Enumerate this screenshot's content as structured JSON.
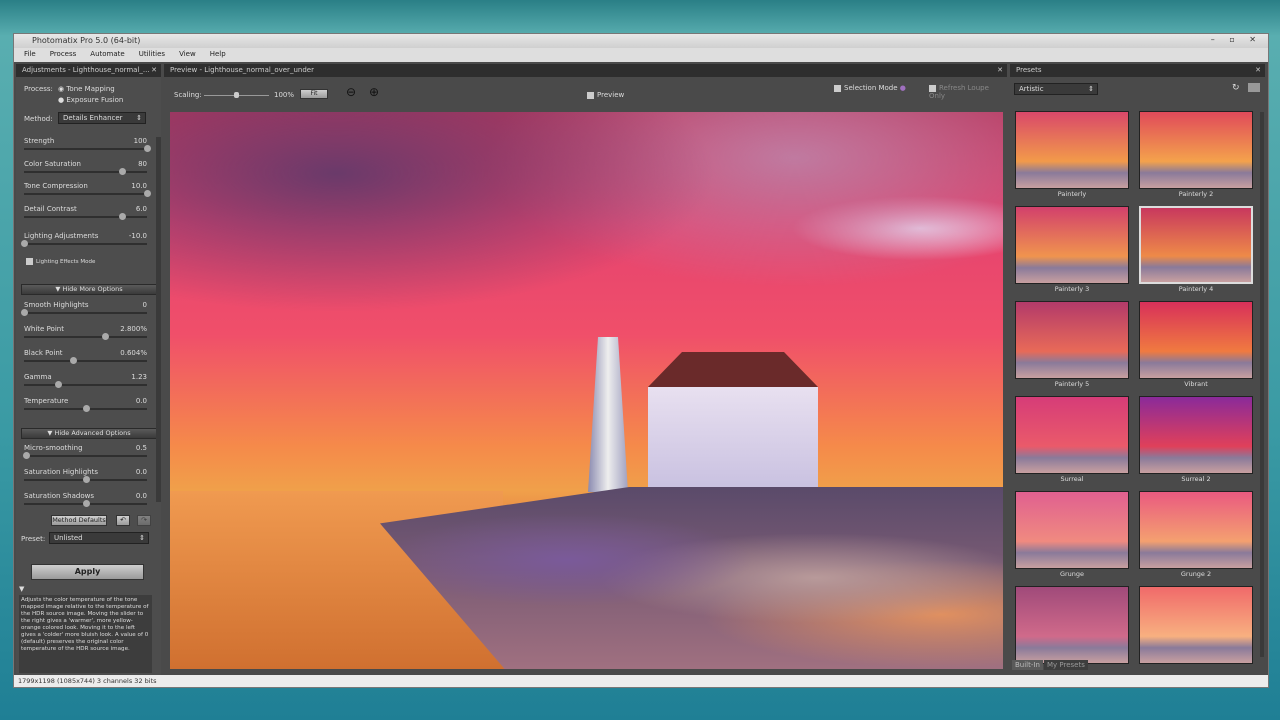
{
  "window": {
    "title": "Photomatix Pro 5.0 (64-bit)",
    "controls": "– ▫ ✕"
  },
  "menu": [
    "File",
    "Process",
    "Automate",
    "Utilities",
    "View",
    "Help"
  ],
  "adjustments": {
    "header": "Adjustments - Lighthouse_normal_...",
    "process_label": "Process:",
    "process_options": [
      "Tone Mapping",
      "Exposure Fusion"
    ],
    "method_label": "Method:",
    "method_value": "Details Enhancer",
    "sliders": [
      {
        "label": "Strength",
        "value": "100",
        "pos": 1.0
      },
      {
        "label": "Color Saturation",
        "value": "80",
        "pos": 0.8
      },
      {
        "label": "Tone Compression",
        "value": "10.0",
        "pos": 1.0
      },
      {
        "label": "Detail Contrast",
        "value": "6.0",
        "pos": 0.8
      },
      {
        "label": "Lighting Adjustments",
        "value": "-10.0",
        "pos": 0.0
      }
    ],
    "lighting_effects_mode": "Lighting Effects Mode",
    "hide_more": "Hide More Options",
    "more_sliders": [
      {
        "label": "Smooth Highlights",
        "value": "0",
        "pos": 0.0
      },
      {
        "label": "White Point",
        "value": "2.800%",
        "pos": 0.66
      },
      {
        "label": "Black Point",
        "value": "0.604%",
        "pos": 0.4
      },
      {
        "label": "Gamma",
        "value": "1.23",
        "pos": 0.28
      },
      {
        "label": "Temperature",
        "value": "0.0",
        "pos": 0.5
      }
    ],
    "hide_advanced": "Hide Advanced Options",
    "adv_sliders": [
      {
        "label": "Micro-smoothing",
        "value": "0.5",
        "pos": 0.02
      },
      {
        "label": "Saturation Highlights",
        "value": "0.0",
        "pos": 0.5
      },
      {
        "label": "Saturation Shadows",
        "value": "0.0",
        "pos": 0.5
      }
    ],
    "method_defaults": "Method Defaults",
    "preset_label": "Preset:",
    "preset_value": "Unlisted",
    "apply": "Apply",
    "help_text": "Adjusts the color temperature of the tone mapped image relative to the temperature of the HDR source image. Moving the slider to the right gives a 'warmer', more yellow-orange colored look. Moving it to the left gives a 'colder' more bluish look. A value of 0 (default) preserves the original color temperature of the HDR source image."
  },
  "preview": {
    "header": "Preview - Lighthouse_normal_over_under",
    "scaling_label": "Scaling:",
    "scaling_value": "100%",
    "scaling_pos": 0.5,
    "fit": "Fit",
    "preview_label": "Preview",
    "selection_mode": "Selection Mode",
    "refresh_loupe": "Refresh Loupe Only"
  },
  "presets": {
    "header": "Presets",
    "category": "Artistic",
    "items": [
      {
        "label": "Painterly",
        "colors": [
          "#d9486a",
          "#f29a4a"
        ]
      },
      {
        "label": "Painterly 2",
        "colors": [
          "#e04a5a",
          "#f4a24c"
        ]
      },
      {
        "label": "Painterly 3",
        "colors": [
          "#d2406c",
          "#f0944e"
        ]
      },
      {
        "label": "Painterly 4",
        "colors": [
          "#c8385e",
          "#ee8a48"
        ]
      },
      {
        "label": "Painterly 5",
        "colors": [
          "#b33a6a",
          "#e86a58"
        ]
      },
      {
        "label": "Vibrant",
        "colors": [
          "#d8305a",
          "#f07a40"
        ]
      },
      {
        "label": "Surreal",
        "colors": [
          "#d63c78",
          "#ea5a6a"
        ]
      },
      {
        "label": "Surreal 2",
        "colors": [
          "#8a2a9a",
          "#e0405a"
        ]
      },
      {
        "label": "Grunge",
        "colors": [
          "#e06090",
          "#f08a80"
        ]
      },
      {
        "label": "Grunge 2",
        "colors": [
          "#ea5a80",
          "#f4a070"
        ]
      },
      {
        "label": "",
        "colors": [
          "#a04a7a",
          "#d06a8a"
        ]
      },
      {
        "label": "",
        "colors": [
          "#f06a6a",
          "#f8b080"
        ]
      }
    ],
    "tabs": [
      "Built-In",
      "My Presets"
    ]
  },
  "status": "1799x1198 (1085x744) 3 channels 32 bits"
}
